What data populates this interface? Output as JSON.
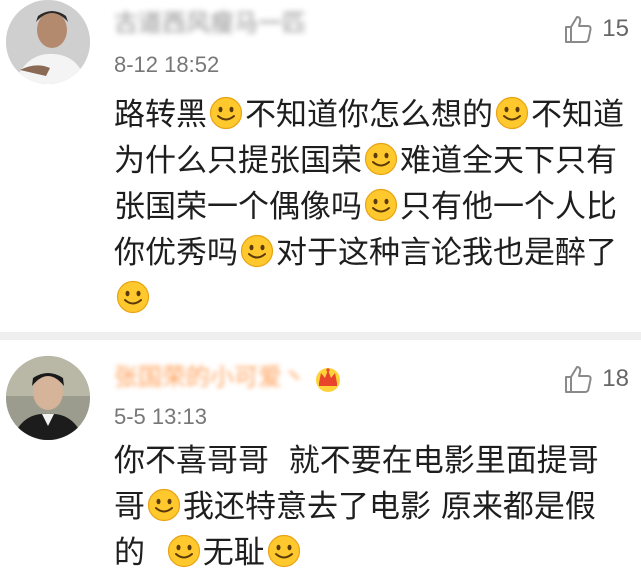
{
  "comments": [
    {
      "username": "古道西风瘦马一匹",
      "timestamp": "8-12 18:52",
      "likes": "15",
      "avatar": "person-portrait-white-shirt",
      "content": [
        "路转黑",
        ":smile:",
        "不知道你怎么想的",
        ":smile:",
        "不知道为什么只提张国荣",
        ":smile:",
        "难道全天下只有张国荣一个偶像吗",
        ":smile:",
        "只有他一个人比你优秀吗",
        ":smile:",
        "对于这种言论我也是醉了",
        ":smile:"
      ]
    },
    {
      "username": "张国荣的小可爱丶",
      "badge": "crown-icon",
      "timestamp": "5-5 13:13",
      "likes": "18",
      "avatar": "person-portrait-dark",
      "content": [
        "你不喜哥哥  就不要在电影里面提哥哥",
        ":smile:",
        "我还特意去了电影 原来都是假的  ",
        ":smile:",
        "无耻",
        ":smile:"
      ]
    }
  ],
  "colors": {
    "vip_username": "#ff7d1d",
    "timestamp": "#777777",
    "divider": "#eeeeee",
    "emoji_face": "#ffc82c"
  }
}
